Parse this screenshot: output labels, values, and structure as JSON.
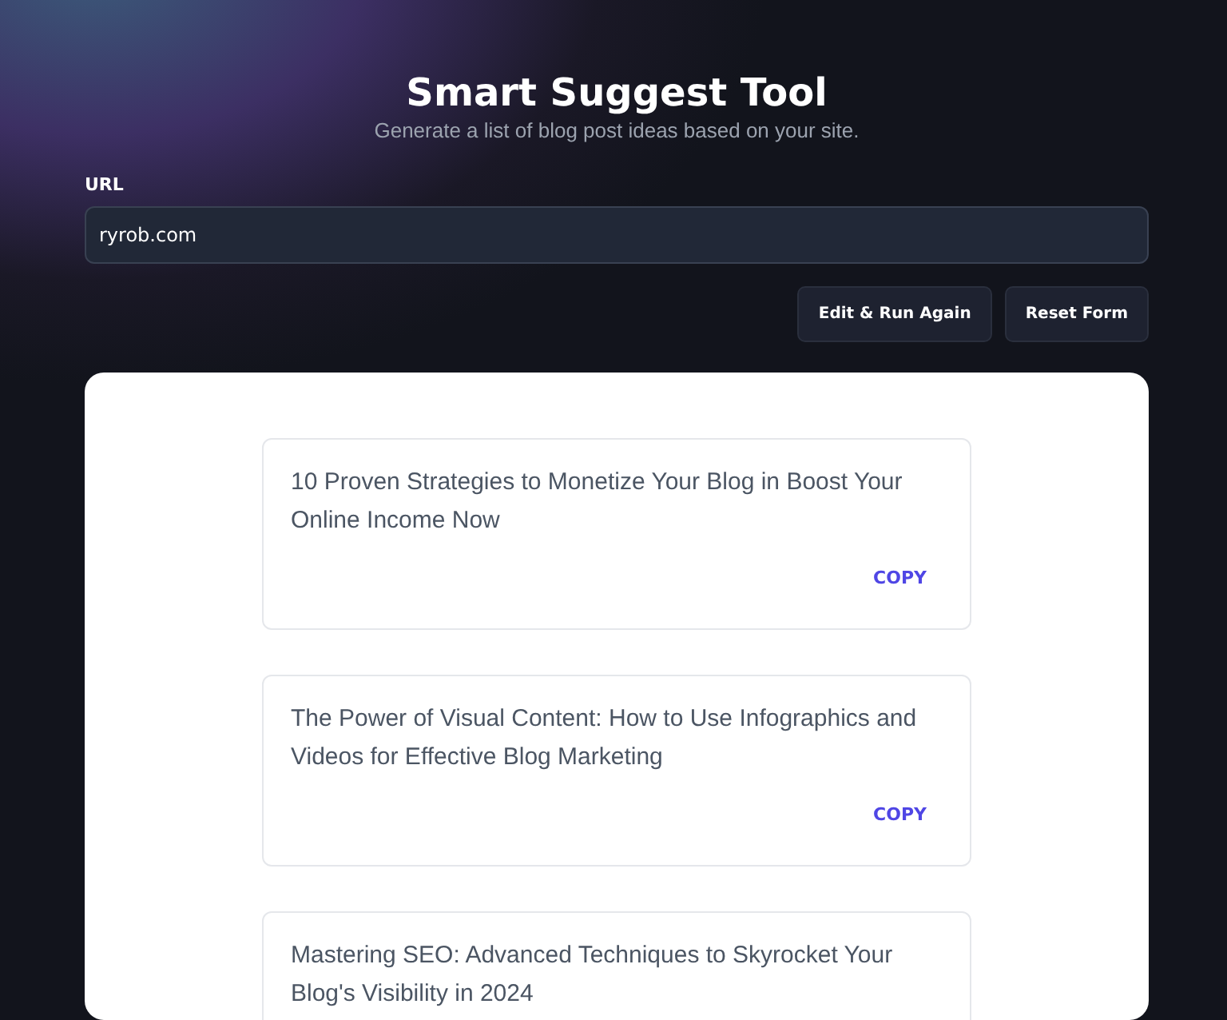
{
  "header": {
    "title": "Smart Suggest Tool",
    "subtitle": "Generate a list of blog post ideas based on your site."
  },
  "form": {
    "url_label": "URL",
    "url_value": "ryrob.com",
    "buttons": [
      "Edit & Run Again",
      "Reset Form"
    ]
  },
  "ideas": [
    {
      "text": "10 Proven Strategies to Monetize Your Blog in Boost Your Online Income Now",
      "action": "COPY"
    },
    {
      "text": "The Power of Visual Content: How to Use Infographics and Videos for Effective Blog Marketing",
      "action": "COPY"
    },
    {
      "text": "Mastering SEO: Advanced Techniques to Skyrocket Your Blog's Visibility in 2024"
    }
  ]
}
